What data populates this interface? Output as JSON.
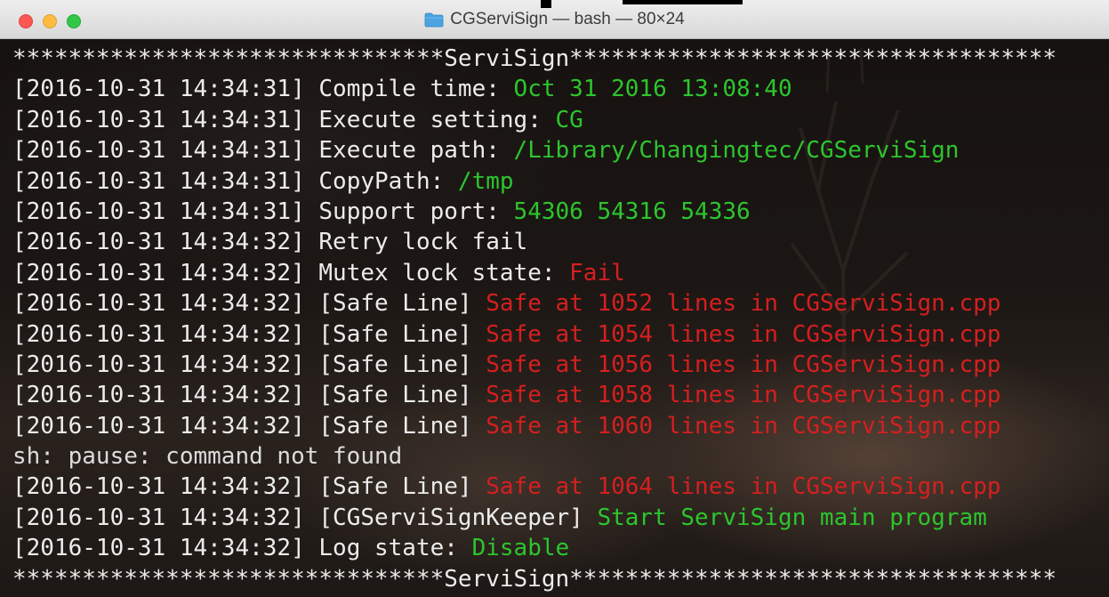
{
  "window": {
    "title": "CGServiSign — bash — 80×24"
  },
  "icons": {
    "folder": "folder-icon"
  },
  "colors": {
    "stamp": "#ececec",
    "value_ok": "#2dc52d",
    "value_error": "#d61f1f"
  },
  "terminal": {
    "lines": [
      {
        "kind": "banner",
        "text": "*******************************ServiSign***********************************"
      },
      {
        "kind": "log",
        "stamp": "[2016-10-31 14:34:31]",
        "label": " Compile time: ",
        "value": "Oct 31 2016 13:08:40",
        "color": "green"
      },
      {
        "kind": "log",
        "stamp": "[2016-10-31 14:34:31]",
        "label": " Execute setting: ",
        "value": "CG",
        "color": "green"
      },
      {
        "kind": "log",
        "stamp": "[2016-10-31 14:34:31]",
        "label": " Execute path: ",
        "value": "/Library/Changingtec/CGServiSign",
        "color": "green"
      },
      {
        "kind": "log",
        "stamp": "[2016-10-31 14:34:31]",
        "label": " CopyPath: ",
        "value": "/tmp",
        "color": "green"
      },
      {
        "kind": "log",
        "stamp": "[2016-10-31 14:34:31]",
        "label": " Support port: ",
        "value": "54306 54316 54336",
        "color": "green"
      },
      {
        "kind": "log",
        "stamp": "[2016-10-31 14:34:32]",
        "label": " Retry lock fail",
        "value": "",
        "color": "green"
      },
      {
        "kind": "log",
        "stamp": "[2016-10-31 14:34:32]",
        "label": " Mutex lock state: ",
        "value": "Fail",
        "color": "red"
      },
      {
        "kind": "log",
        "stamp": "[2016-10-31 14:34:32]",
        "label": " [Safe Line] ",
        "value": "Safe at 1052 lines in CGServiSign.cpp",
        "color": "red"
      },
      {
        "kind": "log",
        "stamp": "[2016-10-31 14:34:32]",
        "label": " [Safe Line] ",
        "value": "Safe at 1054 lines in CGServiSign.cpp",
        "color": "red"
      },
      {
        "kind": "log",
        "stamp": "[2016-10-31 14:34:32]",
        "label": " [Safe Line] ",
        "value": "Safe at 1056 lines in CGServiSign.cpp",
        "color": "red"
      },
      {
        "kind": "log",
        "stamp": "[2016-10-31 14:34:32]",
        "label": " [Safe Line] ",
        "value": "Safe at 1058 lines in CGServiSign.cpp",
        "color": "red"
      },
      {
        "kind": "log",
        "stamp": "[2016-10-31 14:34:32]",
        "label": " [Safe Line] ",
        "value": "Safe at 1060 lines in CGServiSign.cpp",
        "color": "red"
      },
      {
        "kind": "plain",
        "text": "sh: pause: command not found"
      },
      {
        "kind": "log",
        "stamp": "[2016-10-31 14:34:32]",
        "label": " [Safe Line] ",
        "value": "Safe at 1064 lines in CGServiSign.cpp",
        "color": "red"
      },
      {
        "kind": "log",
        "stamp": "[2016-10-31 14:34:32]",
        "label": " [CGServiSignKeeper] ",
        "value": "Start ServiSign main program",
        "color": "green"
      },
      {
        "kind": "log",
        "stamp": "[2016-10-31 14:34:32]",
        "label": " Log state: ",
        "value": "Disable",
        "color": "green"
      },
      {
        "kind": "banner",
        "text": "*******************************ServiSign***********************************"
      }
    ]
  }
}
